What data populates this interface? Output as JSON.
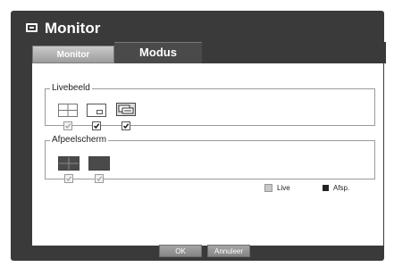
{
  "window": {
    "title": "Monitor",
    "title_icon": "monitor-icon"
  },
  "tabs": [
    {
      "label": "Monitor",
      "active": false
    },
    {
      "label": "Modus",
      "active": true
    }
  ],
  "live_group": {
    "label": "Livebeeld",
    "items": [
      {
        "icon": "split-4-icon",
        "checked": true,
        "enabled": false
      },
      {
        "icon": "pip-icon",
        "checked": true,
        "enabled": true
      },
      {
        "icon": "overlap-icon",
        "checked": true,
        "enabled": true
      }
    ]
  },
  "playback_group": {
    "label": "Afpeelscherm",
    "items": [
      {
        "icon": "split-4-icon",
        "checked": true,
        "enabled": false
      },
      {
        "icon": "single-screen-icon",
        "checked": true,
        "enabled": false
      }
    ]
  },
  "legend": {
    "live_label": "Live",
    "live_color": "#c8c8c8",
    "playback_label": "Afsp.",
    "playback_color": "#222222"
  },
  "buttons": {
    "ok": "OK",
    "cancel": "Annuleer"
  }
}
